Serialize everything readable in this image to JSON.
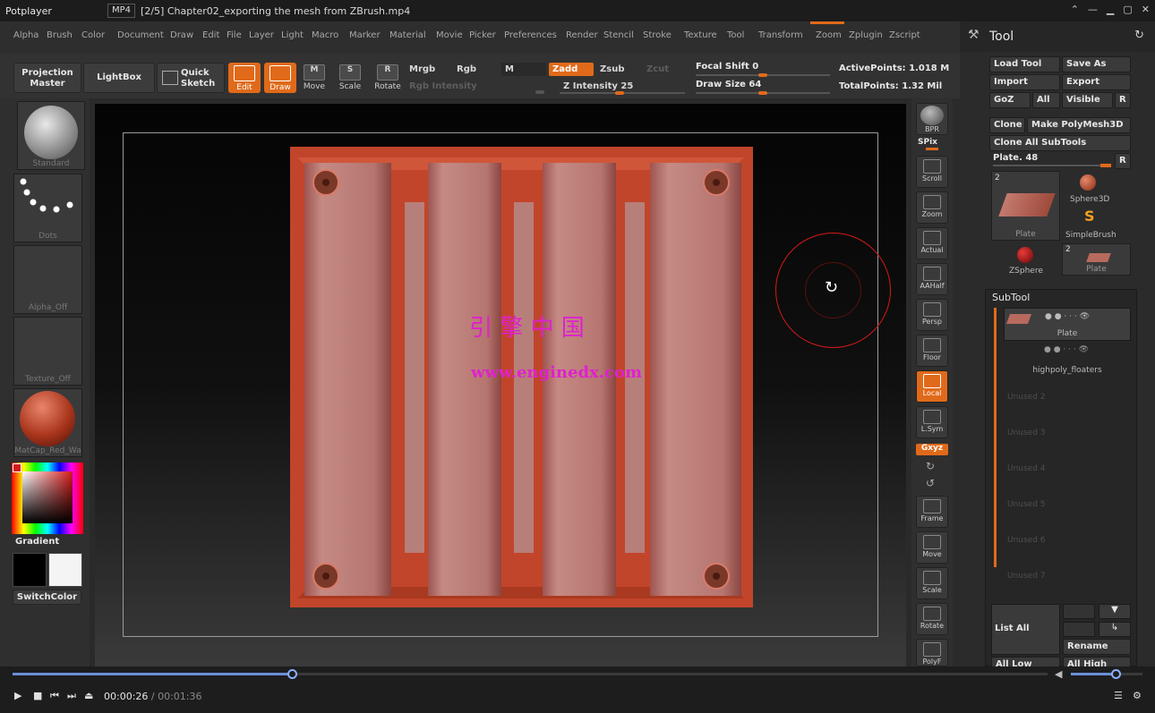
{
  "player": {
    "app_name": "Potplayer",
    "format_badge": "MP4",
    "title": "[2/5] Chapter02_exporting the mesh from ZBrush.mp4",
    "elapsed": "00:00:26",
    "total": "/ 00:01:36",
    "progress": 0.27,
    "volume": 0.62
  },
  "menu": {
    "items": [
      "Alpha",
      "Brush",
      "Color",
      "Document",
      "Draw",
      "Edit",
      "File",
      "Layer",
      "Light",
      "Macro",
      "Marker",
      "Material",
      "Movie",
      "Picker",
      "Preferences",
      "Render",
      "Stencil",
      "Stroke",
      "Texture",
      "Tool",
      "Transform",
      "Zoom",
      "Zplugin",
      "Zscript"
    ]
  },
  "toolbar": {
    "projection_master": "Projection Master",
    "lightbox": "LightBox",
    "quick_sketch": "Quick Sketch",
    "edit": "Edit",
    "draw": "Draw",
    "move": "Move",
    "scale": "Scale",
    "rotate": "Rotate",
    "move_key": "M",
    "scale_key": "S",
    "rotate_key": "R",
    "mrgb": "Mrgb",
    "rgb": "Rgb",
    "m": "M",
    "rgb_intensity": "Rgb Intensity",
    "zadd": "Zadd",
    "zsub": "Zsub",
    "zcut": "Zcut",
    "z_intensity": "Z Intensity 25",
    "focal_shift": "Focal Shift 0",
    "draw_size": "Draw Size 64",
    "active_points": "ActivePoints: 1.018 M",
    "total_points": "TotalPoints: 1.32 Mil"
  },
  "left_shelf": {
    "brush": "Standard",
    "stroke": "Dots",
    "alpha": "Alpha_Off",
    "texture": "Texture_Off",
    "material": "MatCap_Red_Wa",
    "gradient": "Gradient",
    "switch_color": "SwitchColor"
  },
  "canvas": {
    "watermark_cn": "引 擎 中 国",
    "watermark_url": "www.enginedx.com"
  },
  "right_shelf": {
    "bpr": "BPR",
    "spix": "SPix",
    "scroll": "Scroll",
    "zoom": "Zoom",
    "actual": "Actual",
    "aahalf": "AAHalf",
    "persp": "Persp",
    "floor": "Floor",
    "local": "Local",
    "lsym": "L.Sym",
    "xyz": "Gxyz",
    "frame": "Frame",
    "move": "Move",
    "scale": "Scale",
    "rotate": "Rotate",
    "polyf": "PolyF"
  },
  "tool_panel": {
    "title": "Tool",
    "load_tool": "Load Tool",
    "save_as": "Save As",
    "import": "Import",
    "export": "Export",
    "goz": "GoZ",
    "all": "All",
    "visible": "Visible",
    "r": "R",
    "clone": "Clone",
    "make_polymesh": "Make PolyMesh3D",
    "clone_all": "Clone All SubTools",
    "plate_slider": "Plate. 48",
    "thumb_count_1": "2",
    "thumb_count_2": "2",
    "thumb_plate": "Plate",
    "thumb_sphere3d": "Sphere3D",
    "thumb_simplebrush": "SimpleBrush",
    "thumb_zsphere": "ZSphere",
    "thumb_plate2": "Plate",
    "subtool_title": "SubTool",
    "subtool_items": [
      "Plate",
      "highpoly_floaters"
    ],
    "unused": [
      "Unused 2",
      "Unused 3",
      "Unused 4",
      "Unused 5",
      "Unused 6",
      "Unused 7"
    ],
    "list_all": "List All",
    "rename": "Rename",
    "all_low": "All Low",
    "all_high": "All High"
  },
  "colors": {
    "accent": "#e06a1a",
    "plate": "#b5706a",
    "plate_border": "#c1452a",
    "watermark": "#e020d0"
  }
}
